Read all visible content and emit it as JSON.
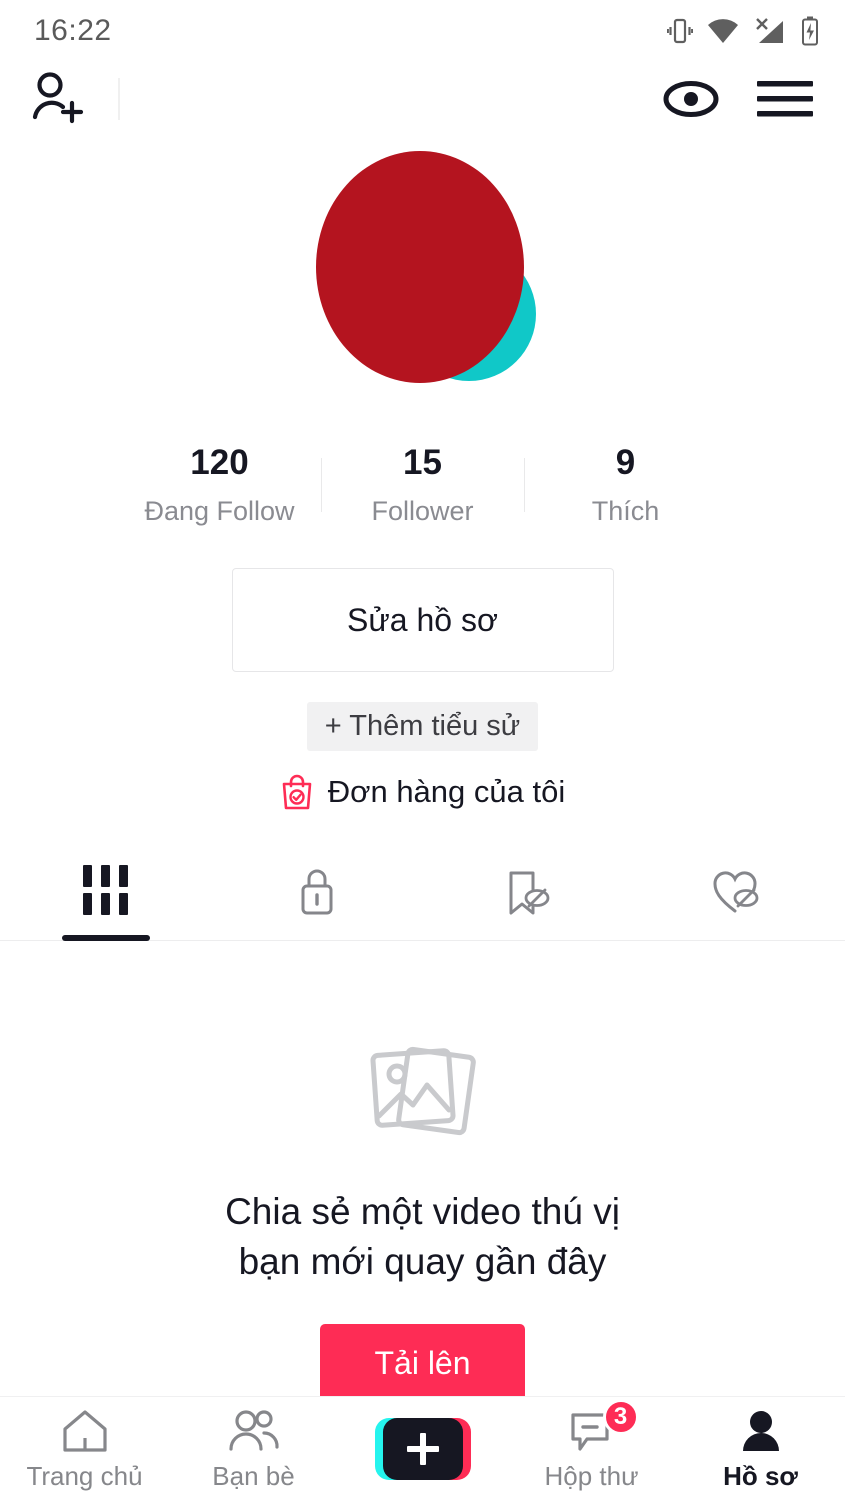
{
  "status_bar": {
    "time": "16:22",
    "icons": [
      "vibrate-icon",
      "wifi-icon",
      "signal-no-sim-icon",
      "battery-charging-icon"
    ]
  },
  "header": {
    "add_friend_icon": "add-person-icon",
    "views_icon": "eye-icon",
    "menu_icon": "hamburger-menu-icon"
  },
  "profile": {
    "avatar_color": "#b4141f",
    "avatar_accent_color": "#10c8c8",
    "stats": [
      {
        "value": "120",
        "label": "Đang Follow"
      },
      {
        "value": "15",
        "label": "Follower"
      },
      {
        "value": "9",
        "label": "Thích"
      }
    ],
    "edit_profile_label": "Sửa hồ sơ",
    "add_bio_label": "+ Thêm tiểu sử",
    "orders_label": "Đơn hàng của tôi",
    "orders_icon": "shopping-bag-check-icon",
    "orders_icon_color": "#fe2c55"
  },
  "tabs": [
    {
      "icon": "grid-icon",
      "active": true
    },
    {
      "icon": "lock-icon",
      "active": false
    },
    {
      "icon": "bookmark-hidden-icon",
      "active": false
    },
    {
      "icon": "heart-hidden-icon",
      "active": false
    }
  ],
  "empty_state": {
    "icon": "photos-placeholder-icon",
    "line1": "Chia sẻ một video thú vị",
    "line2": "bạn mới quay gần đây",
    "upload_label": "Tải lên",
    "upload_color": "#fe2c55"
  },
  "bottom_nav": {
    "items": [
      {
        "label": "Trang chủ",
        "icon": "home-icon",
        "active": false
      },
      {
        "label": "Bạn bè",
        "icon": "friends-icon",
        "active": false
      },
      {
        "label": "",
        "icon": "create-plus-icon",
        "active": false
      },
      {
        "label": "Hộp thư",
        "icon": "inbox-icon",
        "active": false,
        "badge": "3"
      },
      {
        "label": "Hồ sơ",
        "icon": "profile-person-icon",
        "active": true
      }
    ]
  }
}
